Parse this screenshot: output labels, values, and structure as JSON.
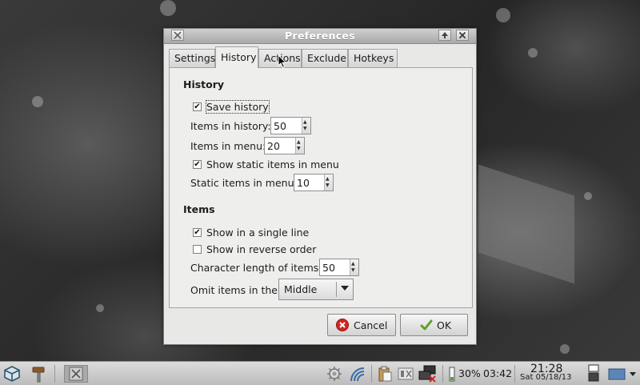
{
  "window": {
    "title": "Preferences",
    "tabs": [
      "Settings",
      "History",
      "Actions",
      "Exclude",
      "Hotkeys"
    ],
    "active_tab": "History"
  },
  "history_section": {
    "title": "History",
    "save_history": {
      "label": "Save history",
      "checked": true
    },
    "items_in_history": {
      "label": "Items in history:",
      "value": "50"
    },
    "items_in_menu": {
      "label": "Items in menu:",
      "value": "20"
    },
    "show_static": {
      "label": "Show static items in menu",
      "checked": true
    },
    "static_items": {
      "label": "Static items in menu:",
      "value": "10"
    }
  },
  "items_section": {
    "title": "Items",
    "single_line": {
      "label": "Show in a single line",
      "checked": true
    },
    "reverse_order": {
      "label": "Show in reverse order",
      "checked": false
    },
    "char_length": {
      "label": "Character length of items:",
      "value": "50"
    },
    "omit": {
      "label": "Omit items in the:",
      "value": "Middle"
    }
  },
  "buttons": {
    "cancel": "Cancel",
    "ok": "OK"
  },
  "taskbar": {
    "battery": "30%",
    "battery_time": "03:42",
    "time": "21:28",
    "date": "Sat 05/18/13"
  },
  "colors": {
    "cancel_icon": "#d2261e",
    "ok_icon": "#5aa02c"
  }
}
